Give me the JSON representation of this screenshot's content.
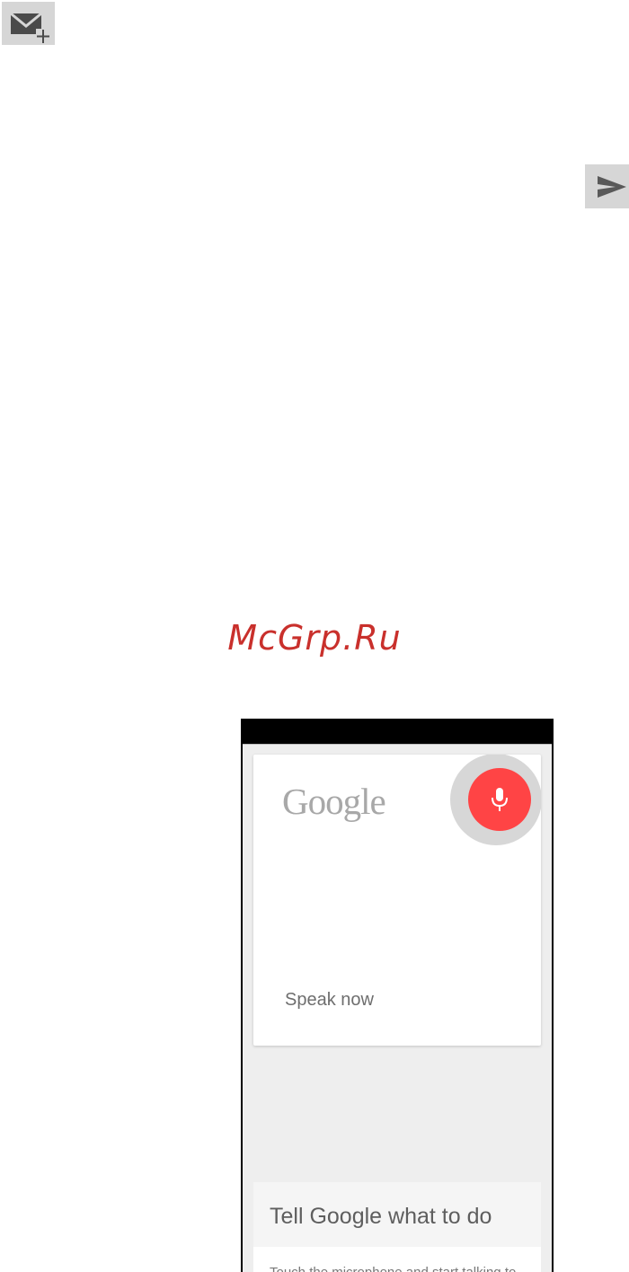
{
  "icons": {
    "compose": "compose-email-icon",
    "send": "send-icon"
  },
  "watermark": {
    "text": "McGrp.Ru"
  },
  "phone": {
    "google_logo": "Google",
    "speak_now": "Speak now",
    "tell_title": "Tell Google what to do",
    "touch_text": "Touch the microphone and start talking to",
    "colors": {
      "mic": "#ff4445",
      "mic_halo": "#d7d7d7",
      "screen_bg": "#eeeeee"
    }
  }
}
